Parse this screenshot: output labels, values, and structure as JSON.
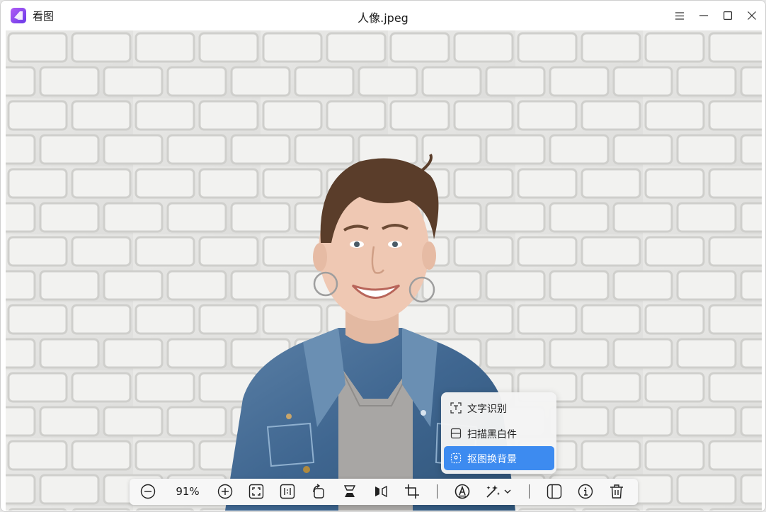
{
  "window": {
    "app_name": "看图",
    "file_title": "人像.jpeg"
  },
  "title_buttons": [
    "menu-icon",
    "minimize-icon",
    "maximize-icon",
    "close-icon"
  ],
  "toolbar": {
    "zoom_value": "91%",
    "tools": [
      "zoom-out-icon",
      "zoom-in-icon",
      "fit-window-icon",
      "actual-size-icon",
      "rotate-icon",
      "flip-vertical-icon",
      "flip-horizontal-icon",
      "crop-icon",
      "ocr-icon",
      "enhance-dropdown-icon",
      "sidebar-icon",
      "info-icon",
      "trash-icon"
    ]
  },
  "enhance_menu": {
    "items": [
      {
        "label": "文字识别",
        "icon": "text-recognition-icon"
      },
      {
        "label": "扫描黑白件",
        "icon": "scan-document-icon"
      },
      {
        "label": "抠图换背景",
        "icon": "cutout-background-icon",
        "active": true
      }
    ]
  },
  "colors": {
    "accent": "#3d8bf0",
    "brick_wall": "#e8e8e6",
    "denim": "#4a6f95",
    "app_logo": "#8a4cf0"
  }
}
